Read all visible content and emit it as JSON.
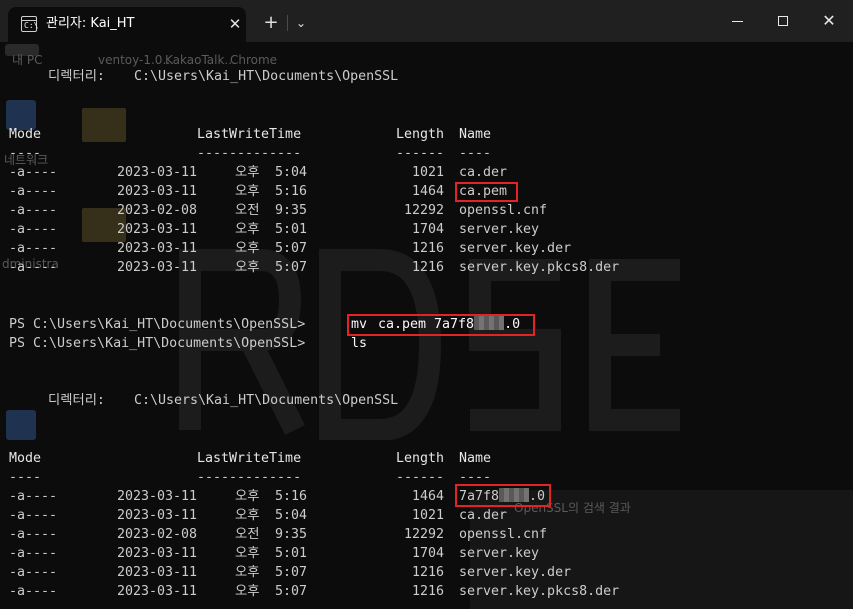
{
  "window": {
    "tab_title": "관리자: Kai_HT",
    "tab_icon_glyph": "C:\\",
    "close_tab_glyph": "✕",
    "new_tab_glyph": "+",
    "dropdown_glyph": "⌄",
    "close_glyph": "✕"
  },
  "background_ghost": {
    "labels": [
      "내 PC",
      "ventoy-1.0...",
      "KakaoTalk...",
      "Chrome",
      "네트워크",
      "dministra",
      "OpenSSL의 검색 결과"
    ]
  },
  "terminal": {
    "dir_label": "디렉터리:",
    "dir_path": "C:\\Users\\Kai_HT\\Documents\\OpenSSL",
    "headers": {
      "mode": "Mode",
      "lastwrite": "LastWriteTime",
      "length": "Length",
      "name": "Name"
    },
    "dashes": {
      "mode": "----",
      "lastwrite": "-------------",
      "length": "------",
      "name": "----"
    },
    "listing1": [
      {
        "mode": "-a----",
        "date": "2023-03-11",
        "ampm": "오후",
        "time": "5:04",
        "length": "1021",
        "name": "ca.der"
      },
      {
        "mode": "-a----",
        "date": "2023-03-11",
        "ampm": "오후",
        "time": "5:16",
        "length": "1464",
        "name": "ca.pem"
      },
      {
        "mode": "-a----",
        "date": "2023-02-08",
        "ampm": "오전",
        "time": "9:35",
        "length": "12292",
        "name": "openssl.cnf"
      },
      {
        "mode": "-a----",
        "date": "2023-03-11",
        "ampm": "오후",
        "time": "5:01",
        "length": "1704",
        "name": "server.key"
      },
      {
        "mode": "-a----",
        "date": "2023-03-11",
        "ampm": "오후",
        "time": "5:07",
        "length": "1216",
        "name": "server.key.der"
      },
      {
        "mode": "-a----",
        "date": "2023-03-11",
        "ampm": "오후",
        "time": "5:07",
        "length": "1216",
        "name": "server.key.pkcs8.der"
      }
    ],
    "prompt": "PS C:\\Users\\Kai_HT\\Documents\\OpenSSL>",
    "cmd1_verb": "mv",
    "cmd1_args_prefix": "ca.pem 7a7f8",
    "cmd1_args_suffix": ".0",
    "cmd2": "ls",
    "listing2_first_name_prefix": "7a7f8",
    "listing2_first_name_suffix": ".0",
    "listing2": [
      {
        "mode": "-a----",
        "date": "2023-03-11",
        "ampm": "오후",
        "time": "5:16",
        "length": "1464"
      },
      {
        "mode": "-a----",
        "date": "2023-03-11",
        "ampm": "오후",
        "time": "5:04",
        "length": "1021",
        "name": "ca.der"
      },
      {
        "mode": "-a----",
        "date": "2023-02-08",
        "ampm": "오전",
        "time": "9:35",
        "length": "12292",
        "name": "openssl.cnf"
      },
      {
        "mode": "-a----",
        "date": "2023-03-11",
        "ampm": "오후",
        "time": "5:01",
        "length": "1704",
        "name": "server.key"
      },
      {
        "mode": "-a----",
        "date": "2023-03-11",
        "ampm": "오후",
        "time": "5:07",
        "length": "1216",
        "name": "server.key.der"
      },
      {
        "mode": "-a----",
        "date": "2023-03-11",
        "ampm": "오후",
        "time": "5:07",
        "length": "1216",
        "name": "server.key.pkcs8.der"
      }
    ]
  },
  "colors": {
    "terminal_bg": "#0c0c0c",
    "titlebar_bg": "#202020",
    "text": "#cccccc",
    "highlight": "#e32424"
  }
}
